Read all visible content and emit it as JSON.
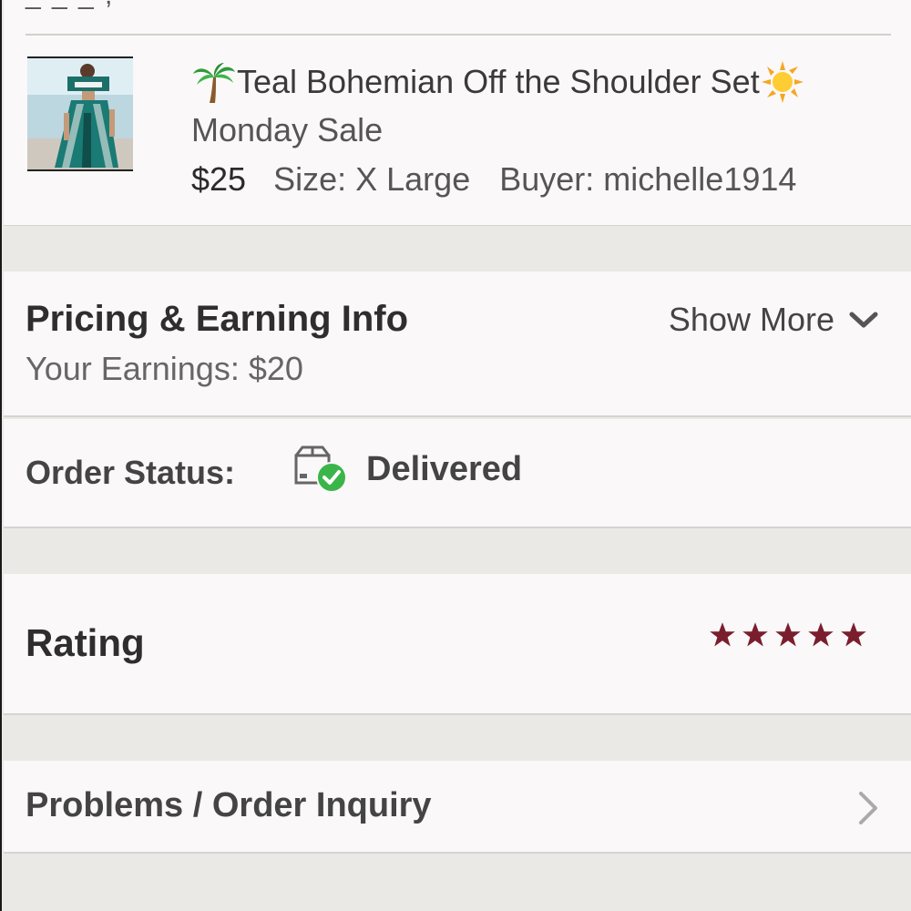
{
  "product": {
    "title_line1": "Teal Bohemian Off the Shoulder Set",
    "title_line2": "Monday Sale",
    "price": "$25",
    "size": "Size: X Large",
    "buyer": "Buyer: michelle1914",
    "title_prefix_emoji": "palm-tree-icon",
    "title_suffix_emoji": "sun-icon"
  },
  "pricing": {
    "heading": "Pricing & Earning Info",
    "earnings": "Your Earnings: $20",
    "show_more_label": "Show More"
  },
  "order_status": {
    "label": "Order Status:",
    "value": "Delivered",
    "status_color": "#3bb54a"
  },
  "rating": {
    "label": "Rating",
    "stars_filled": 5,
    "stars_total": 5,
    "star_color": "#7a1e2e"
  },
  "problems": {
    "label": "Problems / Order Inquiry"
  }
}
